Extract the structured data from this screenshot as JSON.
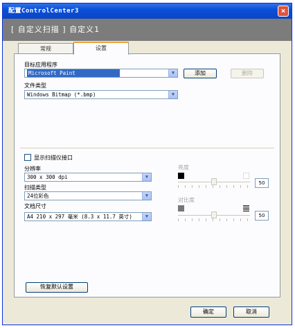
{
  "window": {
    "title": "配置ControlCenter3",
    "close_label": "×"
  },
  "banner": {
    "title": "[ 自定义扫描 ] 自定义1"
  },
  "tabs": [
    {
      "label": "常规"
    },
    {
      "label": "设置"
    }
  ],
  "target_app": {
    "label": "目标应用程序",
    "value": "Microsoft Paint",
    "add_button": "添加",
    "delete_button": "删除"
  },
  "file_type": {
    "label": "文件类型",
    "value": "Windows Bitmap (*.bmp)"
  },
  "show_scanner_interface": {
    "label": "显示扫描仪接口",
    "checked": false
  },
  "resolution": {
    "label": "分辨率",
    "value": "300 x 300 dpi"
  },
  "scan_type": {
    "label": "扫描类型",
    "value": "24位彩色"
  },
  "document_size": {
    "label": "文档尺寸",
    "value": "A4 210 x 297 毫米 (8.3 x 11.7 英寸)"
  },
  "brightness": {
    "label": "亮度",
    "value": "50",
    "level": 50,
    "enabled": false
  },
  "contrast": {
    "label": "对比度",
    "value": "50",
    "level": 50,
    "enabled": false
  },
  "restore_defaults_button": "恢复默认设置",
  "ok_button": "确定",
  "cancel_button": "取消",
  "icons": {
    "close": "close-icon",
    "dropdown": "chevron-down-icon",
    "brightness_low": "dark-square-icon",
    "brightness_high": "light-square-icon",
    "contrast_low": "low-contrast-icon",
    "contrast_high": "high-contrast-icon"
  }
}
